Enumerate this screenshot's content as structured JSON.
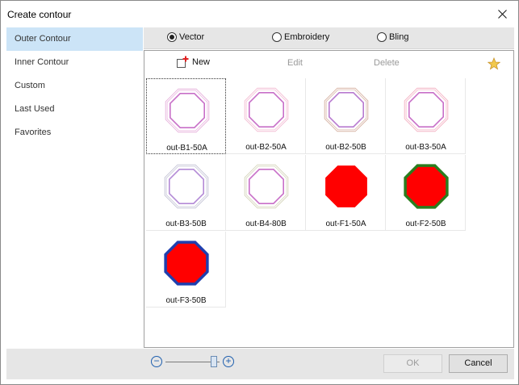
{
  "window": {
    "title": "Create contour"
  },
  "sidebar": {
    "items": [
      {
        "label": "Outer Contour",
        "active": true
      },
      {
        "label": "Inner Contour",
        "active": false
      },
      {
        "label": "Custom",
        "active": false
      },
      {
        "label": "Last Used",
        "active": false
      },
      {
        "label": "Favorites",
        "active": false
      }
    ]
  },
  "mode_options": [
    {
      "label": "Vector",
      "selected": true
    },
    {
      "label": "Embroidery",
      "selected": false
    },
    {
      "label": "Bling",
      "selected": false
    }
  ],
  "toolbar": {
    "new_label": "New",
    "edit_label": "Edit",
    "delete_label": "Delete"
  },
  "items": [
    {
      "label": "out-B1-50A",
      "style": "line",
      "stroke": "#c86fc8",
      "halo": "#e8b6de"
    },
    {
      "label": "out-B2-50A",
      "style": "line",
      "stroke": "#c86fc8",
      "halo": "#f4c0d6"
    },
    {
      "label": "out-B2-50B",
      "style": "line",
      "stroke": "#b87ad0",
      "halo": "#d9b7a8"
    },
    {
      "label": "out-B3-50A",
      "style": "line",
      "stroke": "#c86fc8",
      "halo": "#f4b6c6"
    },
    {
      "label": "out-B3-50B",
      "style": "line",
      "stroke": "#b38ad6",
      "halo": "#c8c8d8"
    },
    {
      "label": "out-B4-80B",
      "style": "line",
      "stroke": "#c86fc8",
      "halo": "#d8d8c0"
    },
    {
      "label": "out-F1-50A",
      "style": "fill",
      "fill": "#ff0000",
      "border": "#ff0000"
    },
    {
      "label": "out-F2-50B",
      "style": "fill",
      "fill": "#ff0000",
      "border": "#2a7d1e"
    },
    {
      "label": "out-F3-50B",
      "style": "fill",
      "fill": "#ff0000",
      "border": "#1f3fae"
    }
  ],
  "buttons": {
    "ok": "OK",
    "cancel": "Cancel"
  },
  "colors": {
    "selection": "#cce4f7",
    "accent": "#1f5fae"
  }
}
